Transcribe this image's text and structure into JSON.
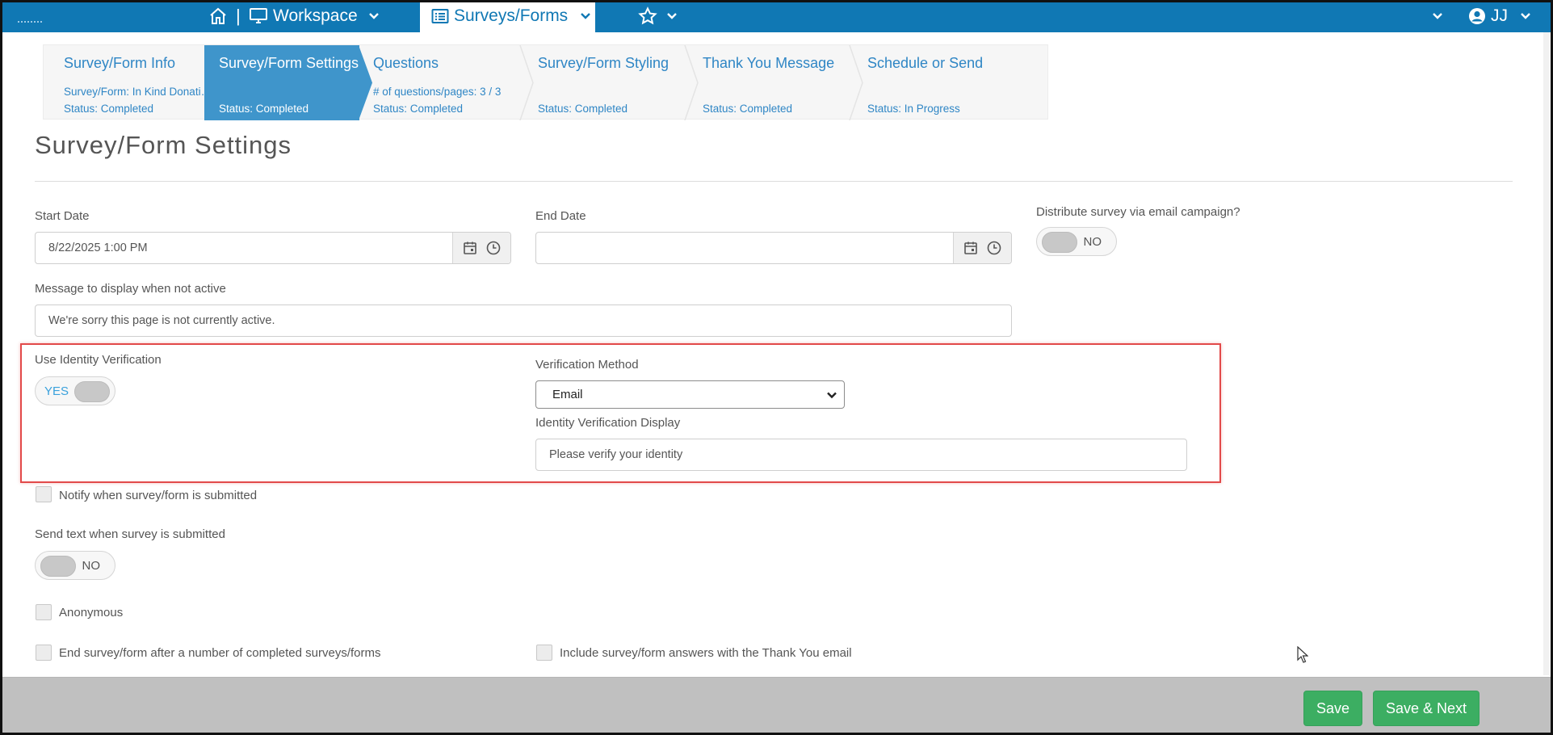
{
  "topbar": {
    "workspace_label": "Workspace",
    "surveys_label": "Surveys/Forms",
    "separator": "|",
    "user_initials": "JJ"
  },
  "steps": [
    {
      "title": "Survey/Form Info",
      "sub": "Survey/Form: In Kind Donati…",
      "status": "Status: Completed"
    },
    {
      "title": "Survey/Form Settings",
      "sub": "",
      "status": "Status: Completed"
    },
    {
      "title": "Questions",
      "sub": "# of questions/pages: 3 / 3",
      "status": "Status: Completed"
    },
    {
      "title": "Survey/Form Styling",
      "sub": "",
      "status": "Status: Completed"
    },
    {
      "title": "Thank You Message",
      "sub": "",
      "status": "Status: Completed"
    },
    {
      "title": "Schedule or Send",
      "sub": "",
      "status": "Status: In Progress"
    }
  ],
  "page": {
    "title": "Survey/Form Settings"
  },
  "form": {
    "start_date_label": "Start Date",
    "start_date_value": "8/22/2025 1:00 PM",
    "end_date_label": "End Date",
    "end_date_value": "",
    "distribute_label": "Distribute survey via email campaign?",
    "distribute_toggle": "NO",
    "inactive_msg_label": "Message to display when not active",
    "inactive_msg_value": "We're sorry this page is not currently active.",
    "identity_label": "Use Identity Verification",
    "identity_toggle": "YES",
    "verification_method_label": "Verification Method",
    "verification_method_value": "Email",
    "identity_display_label": "Identity Verification Display",
    "identity_display_value": "Please verify your identity",
    "notify_label": "Notify when survey/form is submitted",
    "send_text_label": "Send text when survey is submitted",
    "send_text_toggle": "NO",
    "anonymous_label": "Anonymous",
    "end_after_label": "End survey/form after a number of completed surveys/forms",
    "include_answers_label": "Include survey/form answers with the Thank You email"
  },
  "footer": {
    "save_label": "Save",
    "save_next_label": "Save & Next"
  },
  "colors": {
    "topbar": "#1078b4",
    "accent": "#2f86c5",
    "active_step": "#3f95cb",
    "button_green": "#3cae62",
    "highlight_red": "#e24a4a"
  },
  "icons": [
    "home-icon",
    "monitor-icon",
    "chevron-down-icon",
    "list-icon",
    "star-icon",
    "user-circle-icon",
    "calendar-icon",
    "clock-icon"
  ]
}
